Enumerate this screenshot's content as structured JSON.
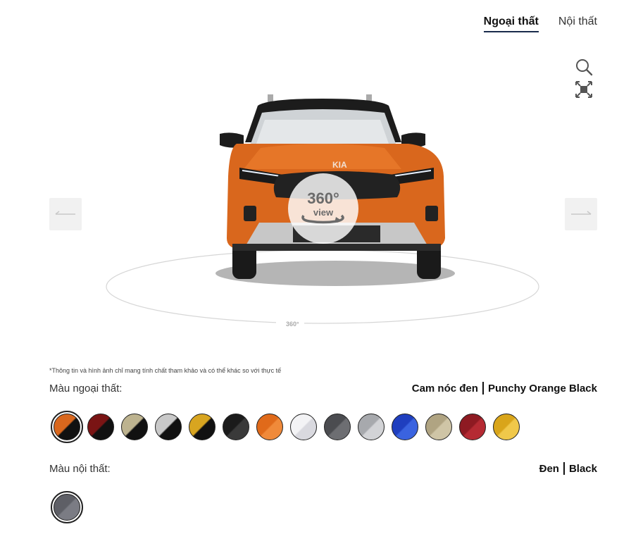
{
  "tabs": [
    {
      "label": "Ngoại thất",
      "active": true
    },
    {
      "label": "Nội thất",
      "active": false
    }
  ],
  "viewer": {
    "badge_big": "360°",
    "badge_small": "view",
    "ring_label": "360°"
  },
  "disclaimer": "*Thông tin và hình ảnh chỉ mang tính chất tham khảo và có thể khác so với thực tế",
  "exterior": {
    "label": "Màu ngoại thất:",
    "selected_name_vi": "Cam nóc đen",
    "selected_name_en": "Punchy Orange Black",
    "swatches": [
      {
        "id": "orange-black",
        "a": "#d9671d",
        "b": "#111111",
        "selected": true
      },
      {
        "id": "red-black",
        "a": "#7a1414",
        "b": "#111111"
      },
      {
        "id": "beige-black",
        "a": "#bdb38f",
        "b": "#111111"
      },
      {
        "id": "silver-black",
        "a": "#c9c9c9",
        "b": "#111111"
      },
      {
        "id": "yellow-black",
        "a": "#d8a520",
        "b": "#111111"
      },
      {
        "id": "black",
        "a": "#1b1b1b",
        "b": "#3a3a3a"
      },
      {
        "id": "orange",
        "a": "#e06a1a",
        "b": "#f08a3a"
      },
      {
        "id": "white",
        "a": "#f3f3f5",
        "b": "#d9d9df"
      },
      {
        "id": "gray",
        "a": "#4b4c50",
        "b": "#6d6e72"
      },
      {
        "id": "silver",
        "a": "#a7a9ad",
        "b": "#d2d3d6"
      },
      {
        "id": "blue",
        "a": "#1f3fbf",
        "b": "#3a63e0"
      },
      {
        "id": "beige",
        "a": "#b0a482",
        "b": "#cfc5a6"
      },
      {
        "id": "red",
        "a": "#8e1a22",
        "b": "#b52a33"
      },
      {
        "id": "yellow",
        "a": "#d9a51a",
        "b": "#f0c84a"
      }
    ]
  },
  "interior": {
    "label": "Màu nội thất:",
    "selected_name_vi": "Đen",
    "selected_name_en": "Black",
    "swatches": [
      {
        "id": "black-interior",
        "a": "#5e5f66",
        "b": "#7b7c84",
        "selected": true
      }
    ]
  }
}
